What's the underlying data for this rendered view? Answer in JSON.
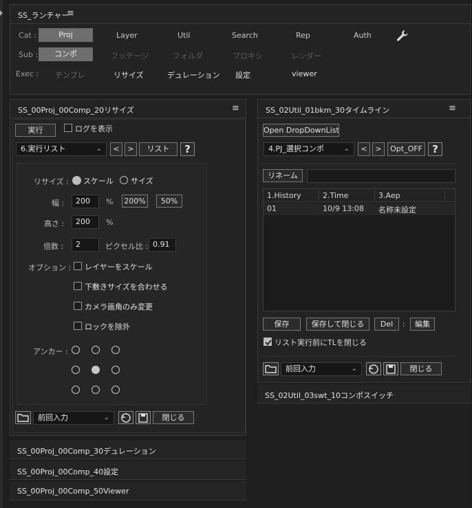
{
  "launcher": {
    "title": "SS_ランチャー",
    "cat_label": "Cat :",
    "sub_label": "Sub :",
    "exec_label": "Exec :",
    "cat_items": [
      "Proj",
      "Layer",
      "Util",
      "Search",
      "Rep",
      "Auth"
    ],
    "sub_items": [
      "コンポ",
      "フッテージ",
      "フォルダ",
      "プロキシ",
      "レンダー"
    ],
    "exec_items": [
      "テンプレ",
      "リサイズ",
      "デュレーション",
      "設定",
      "viewer"
    ]
  },
  "resize_panel": {
    "title": "SS_00Proj_00Comp_20リサイズ",
    "run_button": "実行",
    "show_log": "ログを表示",
    "list_select": "6.実行リスト",
    "prev": "<",
    "next": ">",
    "list_button": "リスト",
    "help": "?",
    "resize_label": "リサイズ :",
    "scale_option": "スケール",
    "size_option": "サイズ",
    "width_label": "幅 :",
    "width_value": "200",
    "percent": "%",
    "btn_200": "200%",
    "btn_50": "50%",
    "height_label": "高さ :",
    "height_value": "200",
    "ratio_label": "倍数 :",
    "ratio_value": "2",
    "pixel_ratio_label": "ピクセル比 :",
    "pixel_ratio_value": "0.91",
    "options_label": "オプション :",
    "opt_scale_layers": "レイヤーをスケール",
    "opt_match_sub": "下敷きサイズを合わせる",
    "opt_camera": "カメラ画角のみ変更",
    "opt_exclude_lock": "ロックを除外",
    "anchor_label": "アンカー :",
    "preset_select": "前回入力",
    "close_button": "閉じる"
  },
  "collapsed_panels": [
    "SS_00Proj_00Comp_30デュレーション",
    "SS_00Proj_00Comp_40設定",
    "SS_00Proj_00Comp_50Viewer"
  ],
  "timeline_panel": {
    "title": "SS_02Util_01bkm_30タイムライン",
    "open_dropdown": "Open DropDownList",
    "select_comp": "4.PJ_選択コンポ",
    "prev": "<",
    "next": ">",
    "opt_button": "Opt_OFF",
    "help": "?",
    "rename_button": "リネーム",
    "rename_value": "",
    "columns": [
      "1.History",
      "2.Time",
      "3.Aep"
    ],
    "rows": [
      [
        "01",
        "10/9 13:08",
        "名称未設定"
      ]
    ],
    "save_button": "保存",
    "save_close_button": "保存して閉じる",
    "del_button": "Del",
    "colon": ":",
    "edit_button": "編集",
    "close_tl": "リスト実行前にTLを閉じる",
    "preset_select": "前回入力",
    "close_button": "閉じる"
  },
  "switch_panel": {
    "title": "SS_02Util_03swt_10コンポスイッチ"
  }
}
